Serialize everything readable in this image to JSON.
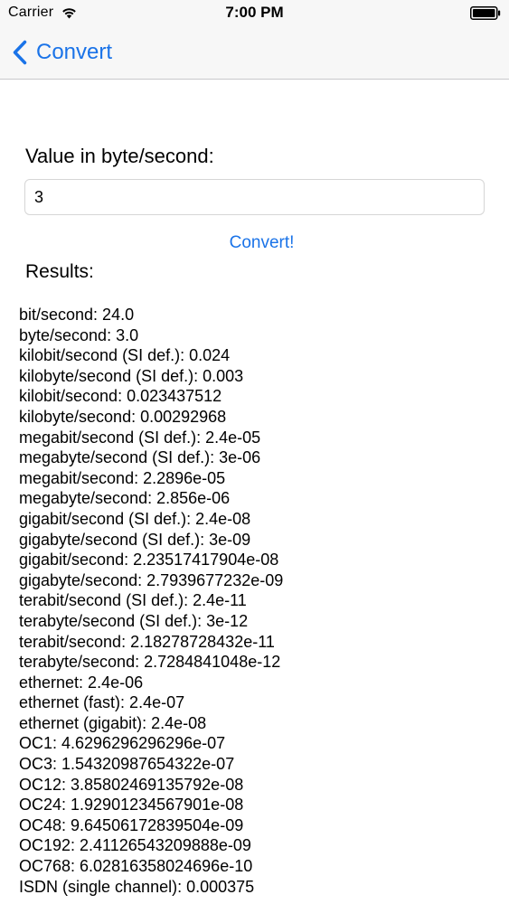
{
  "status_bar": {
    "carrier": "Carrier",
    "time": "7:00 PM",
    "wifi_icon": "wifi-icon",
    "battery_icon": "battery-full-icon"
  },
  "nav": {
    "back_label": "Convert",
    "back_icon": "chevron-left-icon",
    "accent_color": "#1a73e8"
  },
  "form": {
    "value_label": "Value in byte/second:",
    "value": "3",
    "convert_label": "Convert!"
  },
  "results": {
    "label": "Results:",
    "items": [
      "bit/second: 24.0",
      "byte/second: 3.0",
      "kilobit/second (SI def.): 0.024",
      "kilobyte/second (SI def.): 0.003",
      "kilobit/second: 0.023437512",
      "kilobyte/second: 0.00292968",
      "megabit/second (SI def.): 2.4e-05",
      "megabyte/second (SI def.): 3e-06",
      "megabit/second: 2.2896e-05",
      "megabyte/second: 2.856e-06",
      "gigabit/second (SI def.): 2.4e-08",
      "gigabyte/second (SI def.): 3e-09",
      "gigabit/second: 2.23517417904e-08",
      "gigabyte/second: 2.7939677232e-09",
      "terabit/second (SI def.): 2.4e-11",
      "terabyte/second (SI def.): 3e-12",
      "terabit/second: 2.18278728432e-11",
      "terabyte/second: 2.7284841048e-12",
      "ethernet: 2.4e-06",
      "ethernet (fast): 2.4e-07",
      "ethernet (gigabit): 2.4e-08",
      "OC1: 4.6296296296296e-07",
      "OC3: 1.54320987654322e-07",
      "OC12: 3.85802469135792e-08",
      "OC24: 1.92901234567901e-08",
      "OC48: 9.64506172839504e-09",
      "OC192: 2.41126543209888e-09",
      "OC768: 6.02816358024696e-10",
      "ISDN (single channel): 0.000375"
    ]
  }
}
